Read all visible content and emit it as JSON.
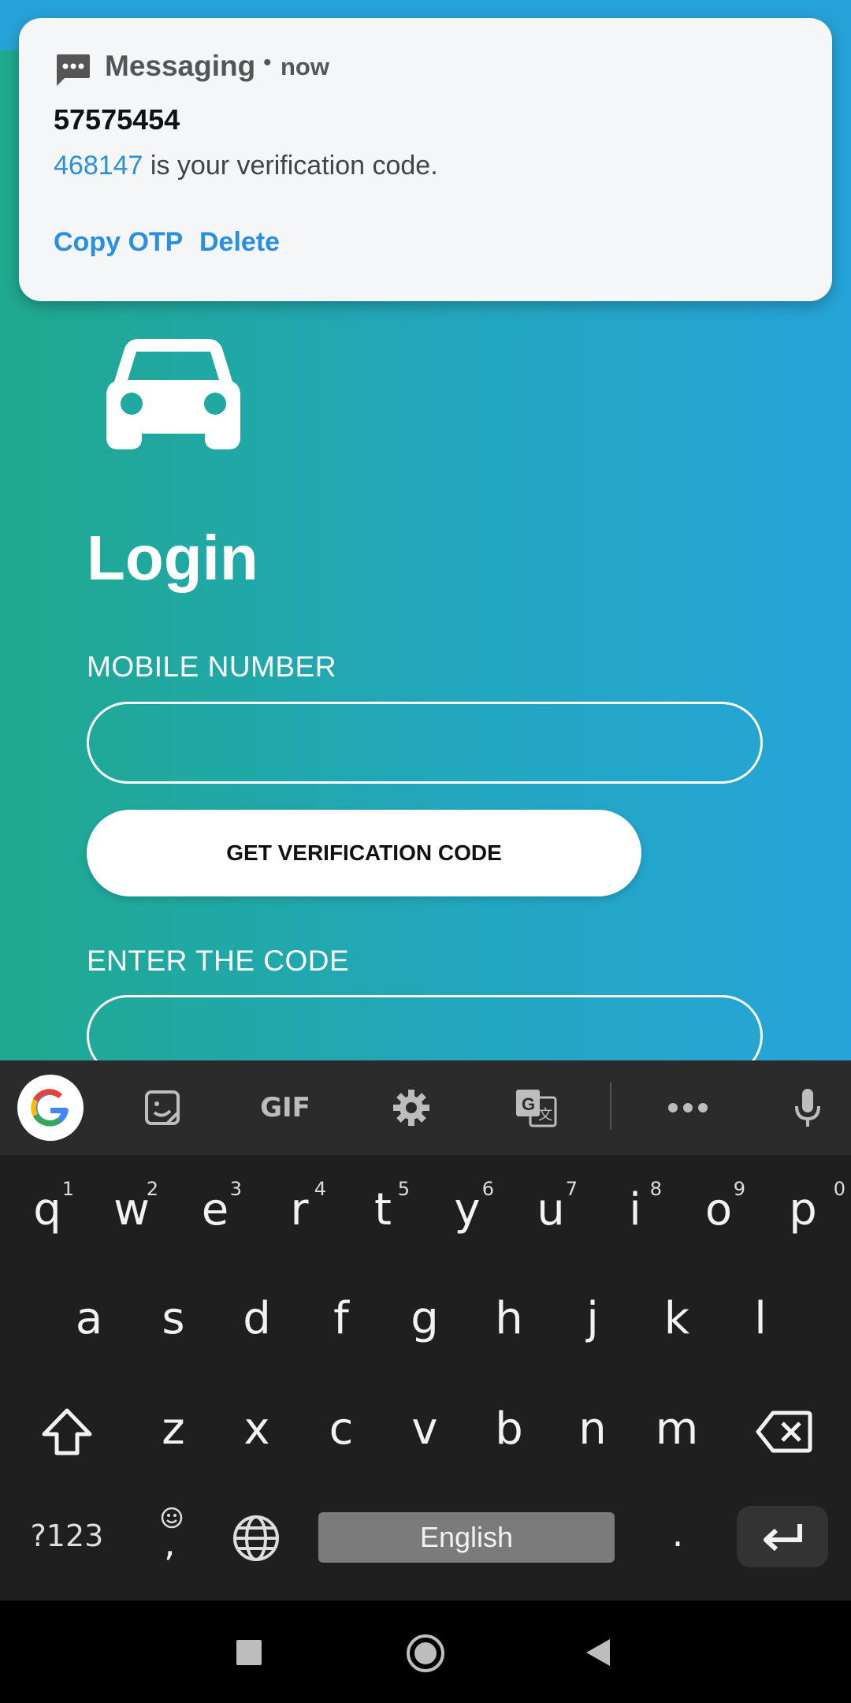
{
  "notification": {
    "app_name": "Messaging",
    "separator": "•",
    "time": "now",
    "sender": "57575454",
    "code": "468147",
    "message_rest": " is your verification code.",
    "actions": [
      "Copy OTP",
      "Delete"
    ]
  },
  "app": {
    "title": "Login",
    "mobile_label": "MOBILE NUMBER",
    "mobile_value": "",
    "get_code_button": "GET VERIFICATION CODE",
    "code_label": "ENTER THE CODE",
    "code_value": ""
  },
  "keyboard": {
    "toolbar": {
      "gif_label": "GIF",
      "icons": [
        "google-icon",
        "sticker-icon",
        "gif-icon",
        "settings-icon",
        "translate-icon",
        "more-icon",
        "mic-icon"
      ]
    },
    "row1": [
      "q",
      "w",
      "e",
      "r",
      "t",
      "y",
      "u",
      "i",
      "o",
      "p"
    ],
    "row1_hints": [
      "1",
      "2",
      "3",
      "4",
      "5",
      "6",
      "7",
      "8",
      "9",
      "0"
    ],
    "row2": [
      "a",
      "s",
      "d",
      "f",
      "g",
      "h",
      "j",
      "k",
      "l"
    ],
    "row3": [
      "z",
      "x",
      "c",
      "v",
      "b",
      "n",
      "m"
    ],
    "symbols_key": "?123",
    "comma_key": ",",
    "period_key": ".",
    "space_label": "English"
  },
  "colors": {
    "gradient_start": "#1fa98f",
    "gradient_end": "#25a4d9",
    "accent_blue": "#2a8fe0",
    "keyboard_bg": "#1f1f1f"
  }
}
